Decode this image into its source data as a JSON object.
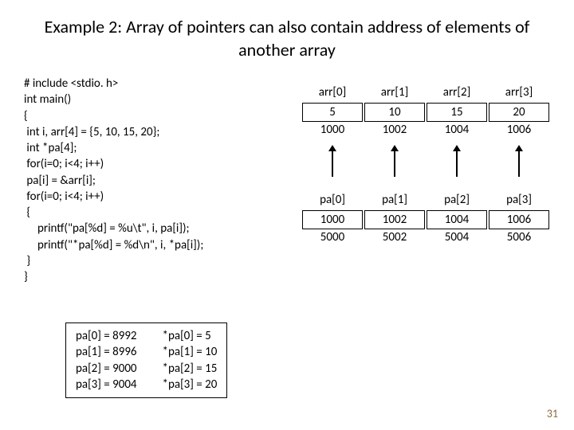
{
  "title": "Example 2: Array of pointers can also contain address of elements of another array",
  "code": "# include <stdio. h>\nint main()\n{\n int i, arr[4] = {5, 10, 15, 20};\n int *pa[4];\n for(i=0; i<4; i++)\n pa[i] = &arr[i];\n for(i=0; i<4; i++)\n {\n     printf(\"pa[%d] = %u\\t\", i, pa[i]);\n     printf(\"*pa[%d] = %d\\n\", i, *pa[i]);\n }\n}",
  "arr": {
    "headers": [
      "arr[0]",
      "arr[1]",
      "arr[2]",
      "arr[3]"
    ],
    "values": [
      "5",
      "10",
      "15",
      "20"
    ],
    "addrs": [
      "1000",
      "1002",
      "1004",
      "1006"
    ]
  },
  "pa": {
    "headers": [
      "pa[0]",
      "pa[1]",
      "pa[2]",
      "pa[3]"
    ],
    "values": [
      "1000",
      "1002",
      "1004",
      "1006"
    ],
    "addrs": [
      "5000",
      "5002",
      "5004",
      "5006"
    ]
  },
  "output_left": "pa[0] = 8992\npa[1] = 8996\npa[2] = 9000\npa[3] = 9004",
  "output_right": "*pa[0] = 5\n*pa[1] = 10\n*pa[2] = 15\n*pa[3] = 20",
  "page_number": "31"
}
